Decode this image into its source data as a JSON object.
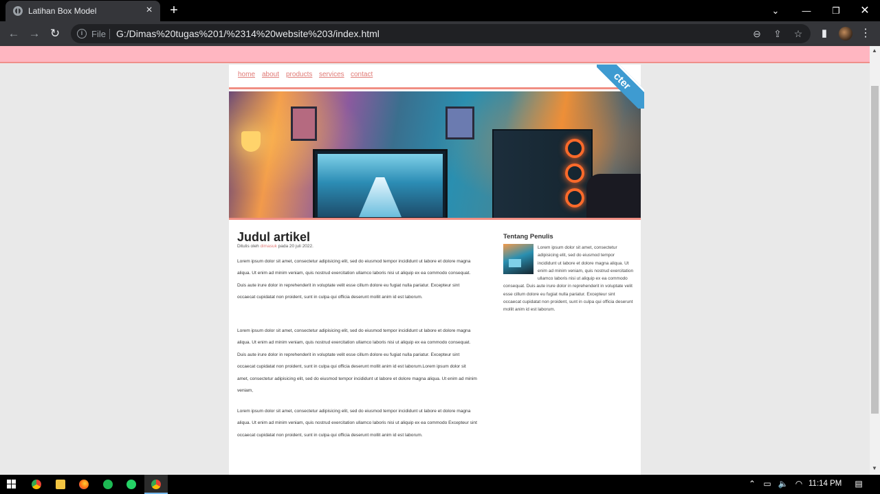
{
  "browser": {
    "tab_title": "Latihan Box Model",
    "scheme_label": "File",
    "url": "G:/Dimas%20tugas%201/%2314%20website%203/index.html"
  },
  "site": {
    "nav": [
      "home",
      "about",
      "products",
      "services",
      "contact"
    ],
    "ribbon_text": "cter",
    "article": {
      "title": "Judul artikel",
      "byline_prefix": "Ditulis oleh ",
      "byline_author": "dimasuk",
      "byline_suffix": " pada 20 juli 2022.",
      "paragraphs": [
        "Lorem ipsum dolor sit amet, consectetur adipisicing elit, sed do eiusmod tempor incididunt ut labore et dolore magna aliqua. Ut enim ad minim veniam, quis nostrud exercitation ullamco laboris nisi ut aliquip ex ea commodo consequat. Duis aute irure dolor in reprehenderit in voluptate velit esse cillum dolore eu fugiat nulla pariatur. Excepteur sint occaecat cupidatat non proident, sunt in culpa qui officia deserunt mollit anim id est laborum.",
        "Lorem ipsum dolor sit amet, consectetur adipisicing elit, sed do eiusmod tempor incididunt ut labore et dolore magna aliqua. Ut enim ad minim veniam, quis nostrud exercitation ullamco laboris nisi ut aliquip ex ea commodo consequat. Duis aute irure dolor in reprehenderit in voluptate velit esse cillum dolore eu fugiat nulla pariatur. Excepteur sint occaecat cupidatat non proident, sunt in culpa qui officia deserunt mollit anim id est laborum.Lorem ipsum dolor sit amet, consectetur adipisicing elit, sed do eiusmod tempor incididunt ut labore et dolore magna aliqua. Ut enim ad minim veniam,",
        "Lorem ipsum dolor sit amet, consectetur adipisicing elit, sed do eiusmod tempor incididunt ut labore et dolore magna aliqua. Ut enim ad minim veniam, quis nostrud exercitation ullamco laboris nisi ut aliquip ex ea commodo Excepteur sint occaecat cupidatat non proident, sunt in culpa qui officia deserunt mollit anim id est laborum."
      ]
    },
    "sidebar": {
      "title": "Tentang Penulis",
      "body": "Lorem ipsum dolor sit amet, consectetur adipisicing elit, sed do eiusmod tempor incididunt ut labore et dolore magna aliqua. Ut enim ad minim veniam, quis nostrud exercitation ullamco laboris nisi ut aliquip ex ea commodo consequat. Duis aute irure dolor in reprehenderit in voluptate velit esse cillum dolore eu fugiat nulla pariatur. Excepteur sint occaecat cupidatat non proident, sunt in culpa qui officia deserunt mollit anim id est laborum."
    }
  },
  "taskbar": {
    "clock": "11:14 PM"
  },
  "colors": {
    "band": "#ffb6c1",
    "accent": "#f08e83",
    "link": "#e07a76",
    "ribbon": "#3e9bd1"
  }
}
